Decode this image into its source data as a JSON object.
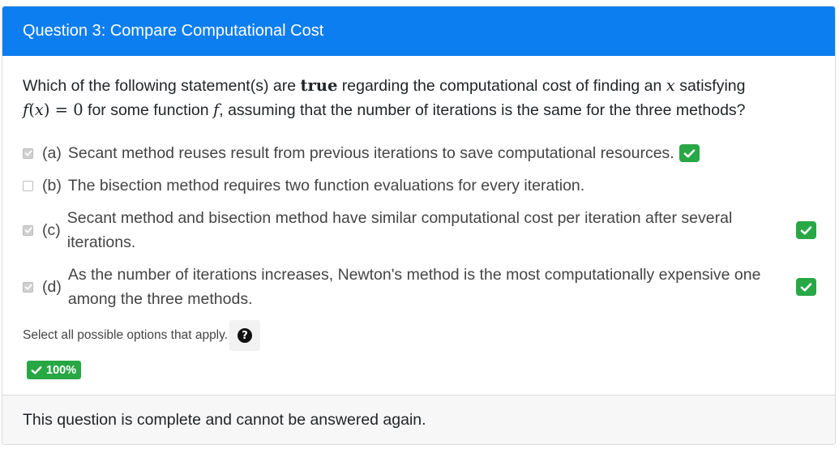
{
  "header": {
    "title": "Question 3: Compare Computational Cost"
  },
  "question": {
    "part1": "Which of the following statement(s) are ",
    "bold_word": "true",
    "part2": " regarding the computational cost of finding an ",
    "var_x": "x",
    "part3": " satisfying",
    "eq_f": "f",
    "eq_paren_open": "(",
    "eq_x": "x",
    "eq_paren_close": ")",
    "eq_equals": " = ",
    "eq_zero": "0",
    "part4": " for some function ",
    "func_f": "f",
    "part5": ", assuming that the number of iterations is the same for the three methods?"
  },
  "options": [
    {
      "letter": "(a)",
      "text": "Secant method reuses result from previous iterations to save computational resources.",
      "checked": true,
      "correct_badge": true
    },
    {
      "letter": "(b)",
      "text": "The bisection method requires two function evaluations for every iteration.",
      "checked": false,
      "correct_badge": false
    },
    {
      "letter": "(c)",
      "text": "Secant method and bisection method have similar computational cost per iteration after several iterations.",
      "checked": true,
      "correct_badge": true
    },
    {
      "letter": "(d)",
      "text": "As the number of iterations increases, Newton's method is the most computationally expensive one among the three methods.",
      "checked": true,
      "correct_badge": true
    }
  ],
  "hint": {
    "text": "Select all possible options that apply.",
    "help_icon": "question-circle-icon"
  },
  "score": {
    "label": "100%",
    "icon": "check-icon"
  },
  "footer": {
    "text": "This question is complete and cannot be answered again."
  },
  "colors": {
    "header_bg": "#0d7ef0",
    "success": "#28a745",
    "footer_bg": "#f7f7f7"
  }
}
